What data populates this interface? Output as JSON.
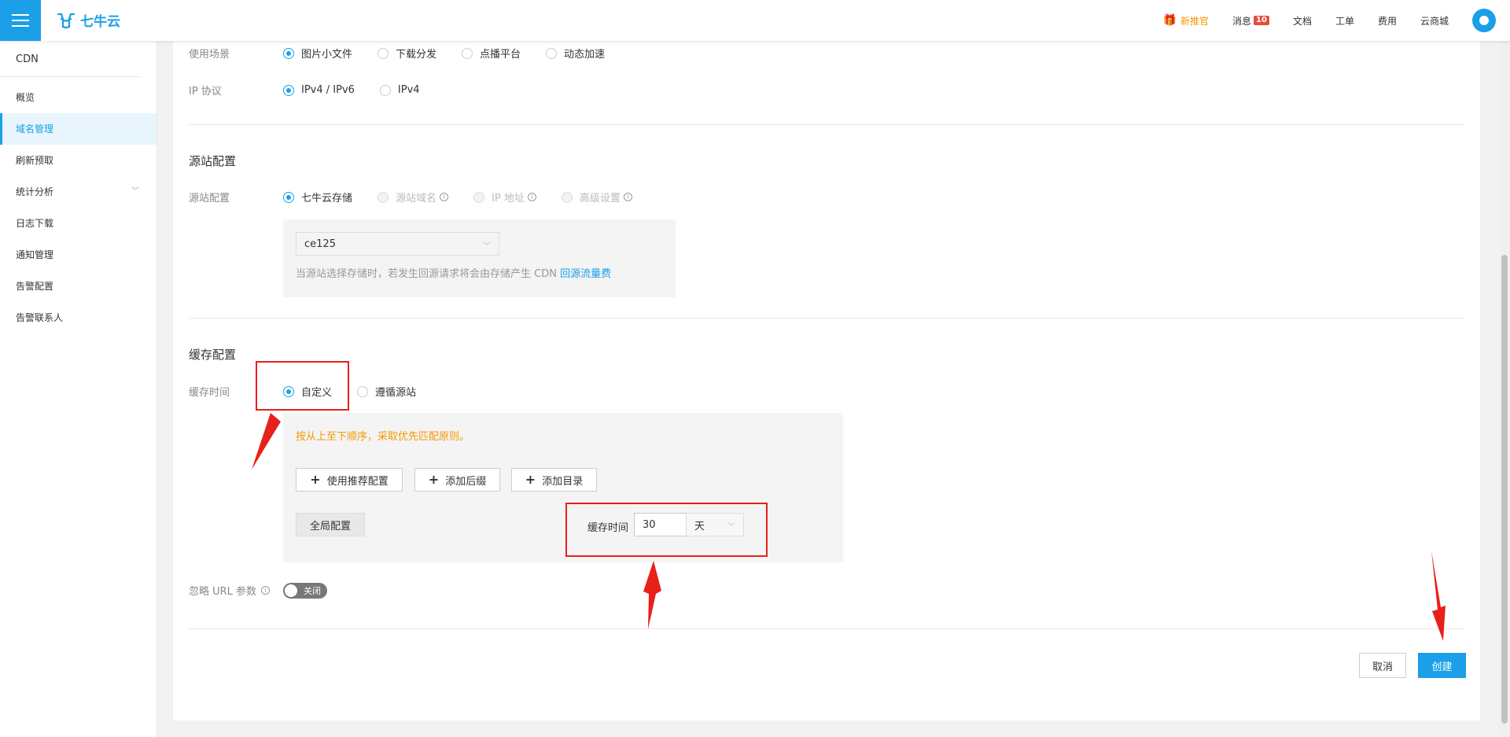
{
  "brand": {
    "logo_text": "七牛云",
    "accent": "#1a9fe8"
  },
  "topnav": {
    "new_officer": "新推官",
    "messages": "消息",
    "messages_count": "10",
    "docs": "文档",
    "ticket": "工单",
    "billing": "费用",
    "store": "云商城"
  },
  "sidebar": {
    "title": "CDN",
    "items": [
      {
        "label": "概览"
      },
      {
        "label": "域名管理",
        "active": true
      },
      {
        "label": "刷新预取"
      },
      {
        "label": "统计分析",
        "expandable": true
      },
      {
        "label": "日志下载"
      },
      {
        "label": "通知管理"
      },
      {
        "label": "告警配置"
      },
      {
        "label": "告警联系人"
      }
    ]
  },
  "form": {
    "usage": {
      "label": "使用场景",
      "options": [
        "图片小文件",
        "下载分发",
        "点播平台",
        "动态加速"
      ],
      "selected": "图片小文件"
    },
    "ip_protocol": {
      "label": "IP 协议",
      "options": [
        "IPv4 / IPv6",
        "IPv4"
      ],
      "selected": "IPv4 / IPv6"
    },
    "origin": {
      "section_title": "源站配置",
      "label": "源站配置",
      "options": [
        "七牛云存储",
        "源站域名",
        "IP 地址",
        "高级设置"
      ],
      "selected": "七牛云存储",
      "bucket_value": "ce125",
      "note_prefix": "当源站选择存储时，若发生回源请求将会由存储产生 CDN ",
      "note_link": "回源流量费"
    },
    "cache": {
      "section_title": "缓存配置",
      "label": "缓存时间",
      "options": [
        "自定义",
        "遵循源站"
      ],
      "selected": "自定义",
      "rule_note": "按从上至下顺序，采取优先匹配原则。",
      "btn_recommended": "使用推荐配置",
      "btn_suffix": "添加后缀",
      "btn_dir": "添加目录",
      "global_label": "全局配置",
      "time_label": "缓存时间",
      "time_value": "30",
      "time_unit": "天"
    },
    "ignore_url": {
      "label": "忽略 URL 参数",
      "toggle_text": "关闭",
      "enabled": false
    },
    "actions": {
      "cancel": "取消",
      "create": "创建"
    }
  }
}
